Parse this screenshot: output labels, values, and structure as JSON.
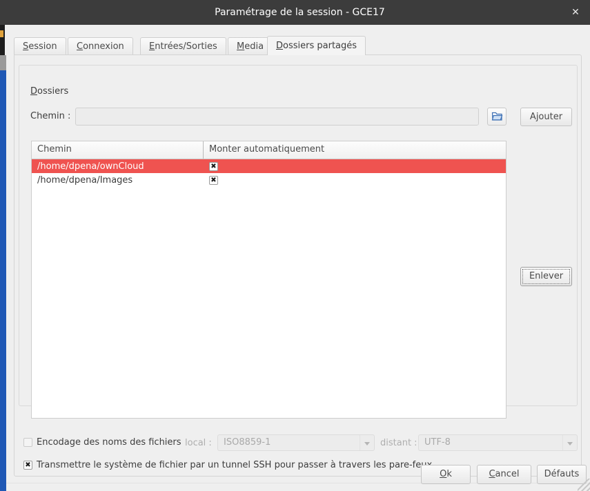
{
  "window": {
    "title": "Paramétrage de la session - GCE17",
    "close_label": "✕"
  },
  "tabs": [
    {
      "label": "Session",
      "mnemonic": "S",
      "active": false
    },
    {
      "label": "Connexion",
      "mnemonic": "C",
      "active": false
    },
    {
      "label": "Entrées/Sorties",
      "mnemonic": "E",
      "active": false
    },
    {
      "label": "Media",
      "mnemonic": "M",
      "active": false
    },
    {
      "label": "Dossiers partagés",
      "mnemonic": "D",
      "active": true
    }
  ],
  "group": {
    "title": "Dossiers",
    "title_mnemonic": "D"
  },
  "path_row": {
    "label": "Chemin :",
    "value": "",
    "placeholder": "",
    "browse_icon": "open-folder-icon",
    "add_label": "Ajouter"
  },
  "table": {
    "columns": [
      "Chemin",
      "Monter automatiquement"
    ],
    "rows": [
      {
        "path": "/home/dpena/ownCloud",
        "auto_mount": true,
        "selected": true
      },
      {
        "path": "/home/dpena/Images",
        "auto_mount": true,
        "selected": false
      }
    ]
  },
  "remove_button": {
    "label": "Enlever"
  },
  "encoding_row": {
    "checkbox_checked": false,
    "label": "Encodage des noms des fichiers",
    "local_label": "local :",
    "local_value": "ISO8859-1",
    "distant_label": "distant :",
    "distant_value": "UTF-8",
    "disabled": true
  },
  "ssh_row": {
    "checkbox_checked": true,
    "label": "Transmettre le système de fichier par un tunnel SSH pour passer à travers les pare-feux"
  },
  "dialog_buttons": {
    "ok": "Ok",
    "ok_mnemonic": "O",
    "cancel": "Cancel",
    "cancel_mnemonic": "C",
    "defaults": "Défauts"
  },
  "colors": {
    "titlebar": "#3c3c3c",
    "selection": "#ef5350",
    "dialog_bg": "#efefef",
    "desktop_blue": "#1f58b5"
  }
}
